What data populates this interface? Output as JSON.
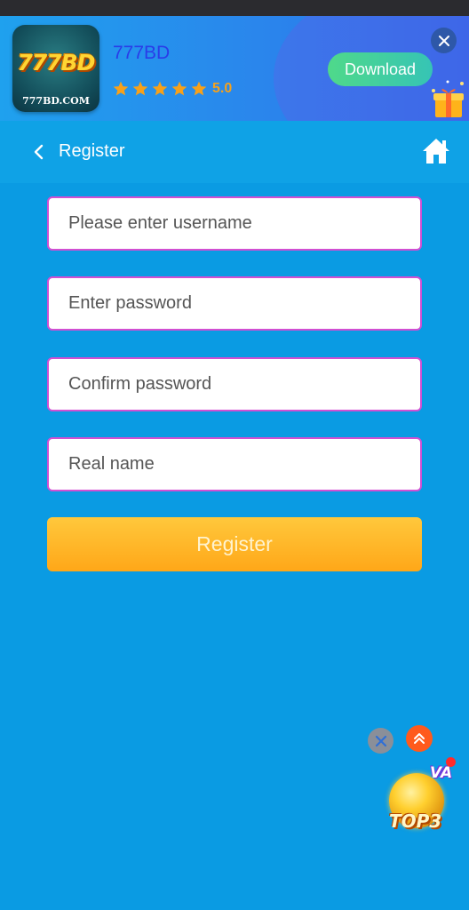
{
  "banner": {
    "app_icon_logo": "777BD",
    "app_icon_domain": "777BD.COM",
    "app_name": "777BD",
    "rating": "5.0",
    "star_count": 5,
    "download_label": "Download",
    "icons": [
      "star-icon",
      "close-icon",
      "gift-icon"
    ]
  },
  "header": {
    "title": "Register",
    "icons": [
      "chevron-left-icon",
      "home-icon"
    ]
  },
  "form": {
    "username_placeholder": "Please enter username",
    "password_placeholder": "Enter password",
    "confirm_password_placeholder": "Confirm password",
    "real_name_placeholder": "Real name",
    "submit_label": "Register"
  },
  "floating": {
    "badge_label": "TOP3",
    "badge_tag": "VA",
    "icons": [
      "close-icon",
      "double-chevron-up-icon"
    ]
  },
  "colors": {
    "page_background": "#0a9be3",
    "field_border": "#d24fd2",
    "register_button": "#ffb527",
    "download_button": "#45d09c",
    "app_name": "#2a3ce8",
    "rating": "#f4a11c"
  }
}
